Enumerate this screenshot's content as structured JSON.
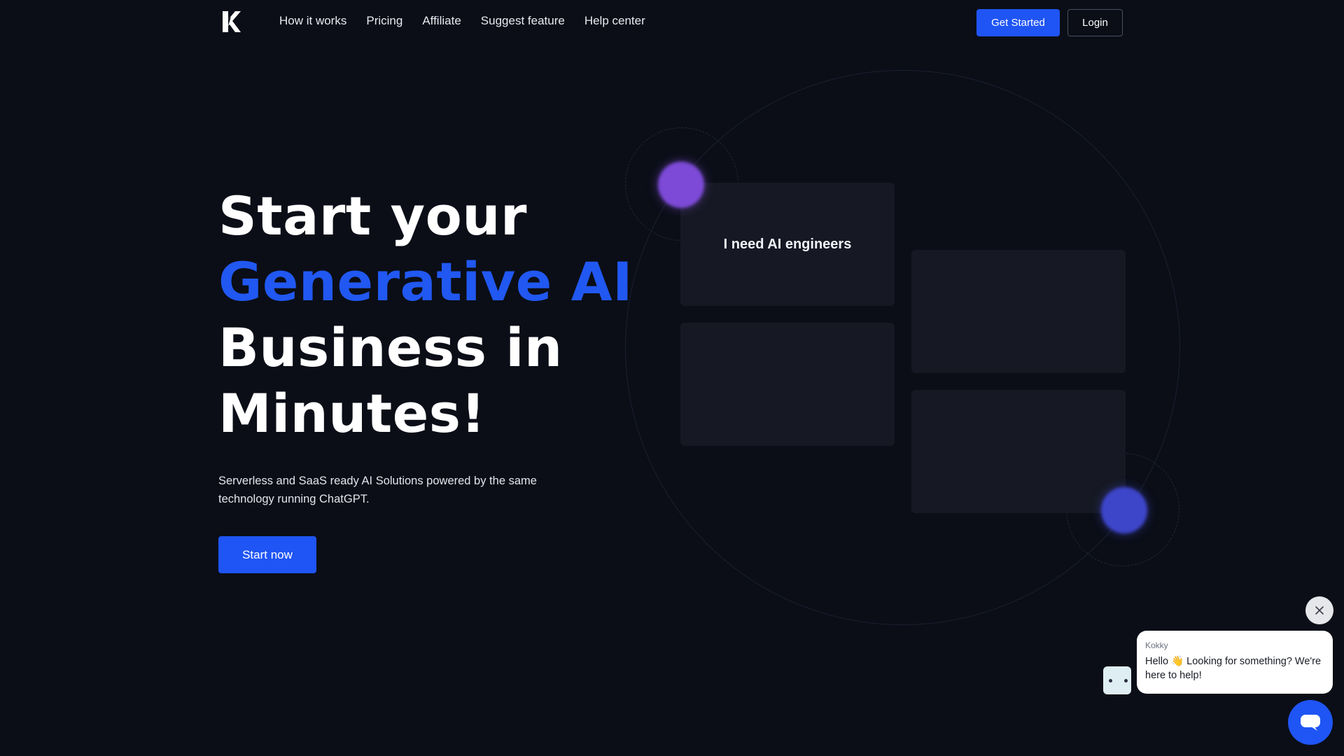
{
  "nav": {
    "links": [
      {
        "label": "How it works"
      },
      {
        "label": "Pricing"
      },
      {
        "label": "Affiliate"
      },
      {
        "label": "Suggest feature"
      },
      {
        "label": "Help center"
      }
    ],
    "get_started_label": "Get Started",
    "login_label": "Login"
  },
  "hero": {
    "title_line1": "Start your",
    "title_accent": "Generative AI",
    "title_line3": "Business in",
    "title_line4": "Minutes!",
    "subtitle": "Serverless and SaaS ready AI Solutions powered by the same technology running ChatGPT.",
    "cta_label": "Start now"
  },
  "visual": {
    "card_text": "I need AI engineers"
  },
  "chat": {
    "agent_name": "Kokky",
    "message": "Hello 👋 Looking for something? We're here to help!"
  },
  "colors": {
    "background": "#0b0e17",
    "accent": "#1f55f5",
    "orb_purple": "#7c4ad6",
    "orb_blue": "#3d45c9"
  },
  "icons": [
    "logo-k-icon",
    "close-icon",
    "chat-icon",
    "bot-avatar-icon"
  ]
}
